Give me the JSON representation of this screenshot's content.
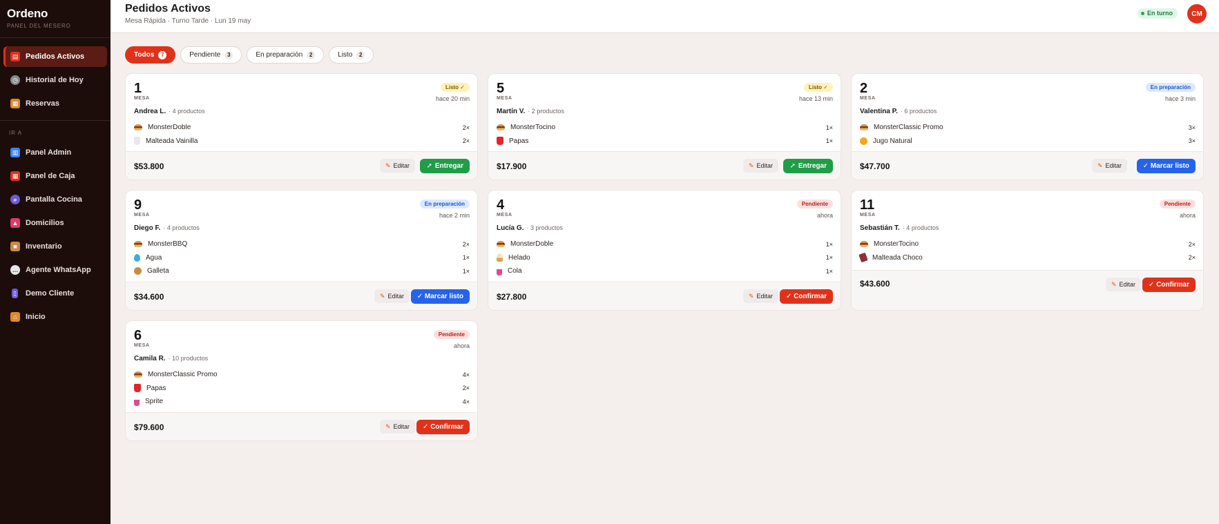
{
  "brand": {
    "title": "Ordeno",
    "subtitle": "PANEL DEL MESERO"
  },
  "nav": {
    "primary": [
      {
        "label": "Pedidos Activos",
        "icon": "receipt-icon",
        "color": "#e0321a",
        "active": true
      },
      {
        "label": "Historial de Hoy",
        "icon": "clock-icon",
        "color": "#8a8a8a"
      },
      {
        "label": "Reservas",
        "icon": "calendar-icon",
        "color": "#d98a2b"
      }
    ],
    "section_label": "IR A",
    "secondary": [
      {
        "label": "Panel Admin",
        "icon": "bar-chart-icon",
        "color": "#3b82f6"
      },
      {
        "label": "Panel de Caja",
        "icon": "cash-register-icon",
        "color": "#e0321a"
      },
      {
        "label": "Pantalla Cocina",
        "icon": "search-icon",
        "color": "#6b5bd6"
      },
      {
        "label": "Domicilios",
        "icon": "shoe-icon",
        "color": "#e03a6a"
      },
      {
        "label": "Inventario",
        "icon": "box-icon",
        "color": "#c98a44"
      },
      {
        "label": "Agente WhatsApp",
        "icon": "chat-bubble-icon",
        "color": "#e8e8e8"
      },
      {
        "label": "Demo Cliente",
        "icon": "phone-icon",
        "color": "#6b5bd6"
      },
      {
        "label": "Inicio",
        "icon": "home-icon",
        "color": "#e08a2b"
      }
    ]
  },
  "header": {
    "title": "Pedidos Activos",
    "subtitle": "Mesa Rápida · Turno Tarde · Lun 19 may",
    "shift_status": "En turno",
    "avatar_initials": "CM"
  },
  "filters": [
    {
      "label": "Todos",
      "count": "7",
      "active": true
    },
    {
      "label": "Pendiente",
      "count": "3"
    },
    {
      "label": "En preparación",
      "count": "2"
    },
    {
      "label": "Listo",
      "count": "2"
    }
  ],
  "edit_label": "Editar",
  "orders": [
    {
      "table": "1",
      "table_label": "MESA",
      "status": "Listo ✓",
      "time": "hace 20 min",
      "customer": "Andrea L.",
      "product_count": "· 4 productos",
      "items": [
        {
          "name": "MonsterDoble",
          "qty": "2×",
          "icon": "burger-icon"
        },
        {
          "name": "Malteada Vainilla",
          "qty": "2×",
          "icon": "milkshake-icon"
        }
      ],
      "total": "$53.800",
      "action": "Entregar",
      "action_icon": "rocket-icon"
    },
    {
      "table": "5",
      "table_label": "MESA",
      "status": "Listo ✓",
      "time": "hace 13 min",
      "customer": "Martín V.",
      "product_count": "· 2 productos",
      "items": [
        {
          "name": "MonsterTocino",
          "qty": "1×",
          "icon": "burger-icon"
        },
        {
          "name": "Papas",
          "qty": "1×",
          "icon": "fries-icon"
        }
      ],
      "total": "$17.900",
      "action": "Entregar",
      "action_icon": "rocket-icon"
    },
    {
      "table": "2",
      "table_label": "MESA",
      "status": "En preparación",
      "time": "hace 3 min",
      "customer": "Valentina P.",
      "product_count": "· 6 productos",
      "items": [
        {
          "name": "MonsterClassic Promo",
          "qty": "3×",
          "icon": "burger-icon"
        },
        {
          "name": "Jugo Natural",
          "qty": "3×",
          "icon": "juice-icon"
        }
      ],
      "total": "$47.700",
      "action": "✓ Marcar listo"
    },
    {
      "table": "9",
      "table_label": "MESA",
      "status": "En preparación",
      "time": "hace 2 min",
      "customer": "Diego F.",
      "product_count": "· 4 productos",
      "items": [
        {
          "name": "MonsterBBQ",
          "qty": "2×",
          "icon": "burger-icon"
        },
        {
          "name": "Agua",
          "qty": "1×",
          "icon": "water-drop-icon"
        },
        {
          "name": "Galleta",
          "qty": "1×",
          "icon": "cookie-icon"
        }
      ],
      "total": "$34.600",
      "action": "✓ Marcar listo"
    },
    {
      "table": "4",
      "table_label": "MESA",
      "status": "Pendiente",
      "time": "ahora",
      "customer": "Lucía G.",
      "product_count": "· 3 productos",
      "items": [
        {
          "name": "MonsterDoble",
          "qty": "1×",
          "icon": "burger-icon"
        },
        {
          "name": "Helado",
          "qty": "1×",
          "icon": "ice-cream-icon"
        },
        {
          "name": "Cola",
          "qty": "1×",
          "icon": "cup-icon"
        }
      ],
      "total": "$27.800",
      "action": "✓ Confirmar"
    },
    {
      "table": "11",
      "table_label": "MESA",
      "status": "Pendiente",
      "time": "ahora",
      "customer": "Sebastián T.",
      "product_count": "· 4 productos",
      "items": [
        {
          "name": "MonsterTocino",
          "qty": "2×",
          "icon": "burger-icon"
        },
        {
          "name": "Malteada Choco",
          "qty": "2×",
          "icon": "chocolate-icon"
        }
      ],
      "total": "$43.600",
      "action": "✓ Confirmar"
    },
    {
      "table": "6",
      "table_label": "MESA",
      "status": "Pendiente",
      "time": "ahora",
      "customer": "Camila R.",
      "product_count": "· 10 productos",
      "items": [
        {
          "name": "MonsterClassic Promo",
          "qty": "4×",
          "icon": "burger-icon"
        },
        {
          "name": "Papas",
          "qty": "2×",
          "icon": "fries-icon"
        },
        {
          "name": "Sprite",
          "qty": "4×",
          "icon": "cup-icon"
        }
      ],
      "total": "$79.600",
      "action": "✓ Confirmar"
    }
  ],
  "colors": {
    "accent": "#e0321a",
    "sidebar_bg": "#1c0d0a",
    "deliver": "#1f9d47",
    "mark_ready": "#2563eb",
    "confirm": "#e0321a"
  }
}
